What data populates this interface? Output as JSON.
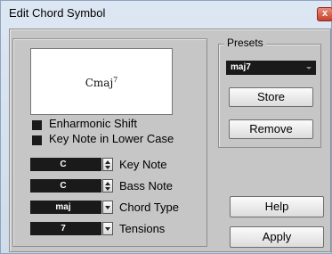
{
  "window": {
    "title": "Edit Chord Symbol",
    "close_glyph": "x"
  },
  "preview": {
    "chord_base": "Cmaj",
    "chord_sup": "7"
  },
  "options": {
    "enharmonic_shift": "Enharmonic Shift",
    "key_note_lower_case": "Key Note in Lower Case"
  },
  "fields": {
    "key_note": {
      "value": "C",
      "label": "Key Note"
    },
    "bass_note": {
      "value": "C",
      "label": "Bass Note"
    },
    "chord_type": {
      "value": "maj",
      "label": "Chord Type"
    },
    "tensions": {
      "value": "7",
      "label": "Tensions"
    }
  },
  "presets": {
    "group_label": "Presets",
    "selected": "maj7",
    "store_label": "Store",
    "remove_label": "Remove"
  },
  "buttons": {
    "help": "Help",
    "apply": "Apply"
  },
  "icons": {
    "close": "close-icon",
    "spinner": "spinner-arrows-icon",
    "dropdown": "chevron-down-icon"
  },
  "colors": {
    "field_bg": "#1a1a1a",
    "dialog_bg": "#c6c6c6",
    "close_red": "#c8402d"
  }
}
